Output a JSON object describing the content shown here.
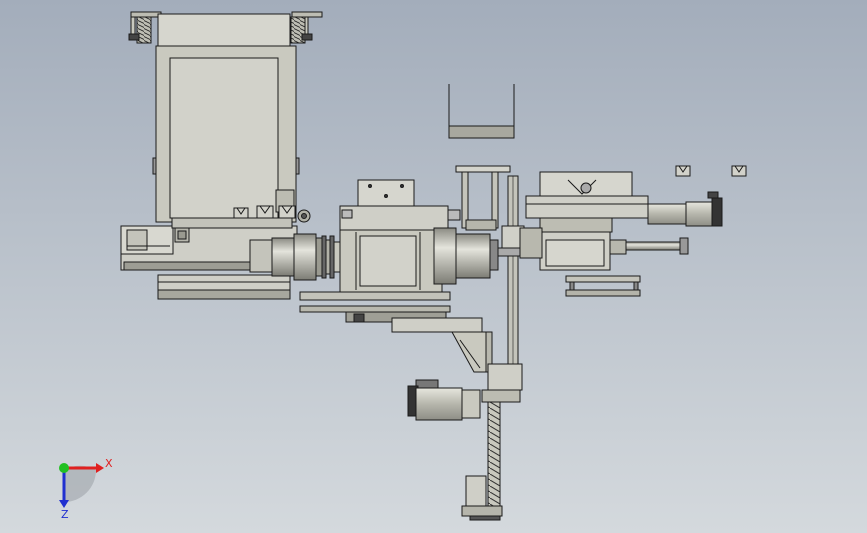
{
  "viewport": {
    "background_top": "#a3adbb",
    "background_bottom": "#d4d9dd"
  },
  "model": {
    "part_fill": "#c9c9bf",
    "part_fill_dark": "#a9a9a0",
    "part_fill_light": "#deded6",
    "edge_color": "#1a1a1a"
  },
  "triad": {
    "x_label": "X",
    "z_label": "Z",
    "x_color": "#e02020",
    "y_color": "#22c022",
    "z_color": "#2030d0"
  }
}
